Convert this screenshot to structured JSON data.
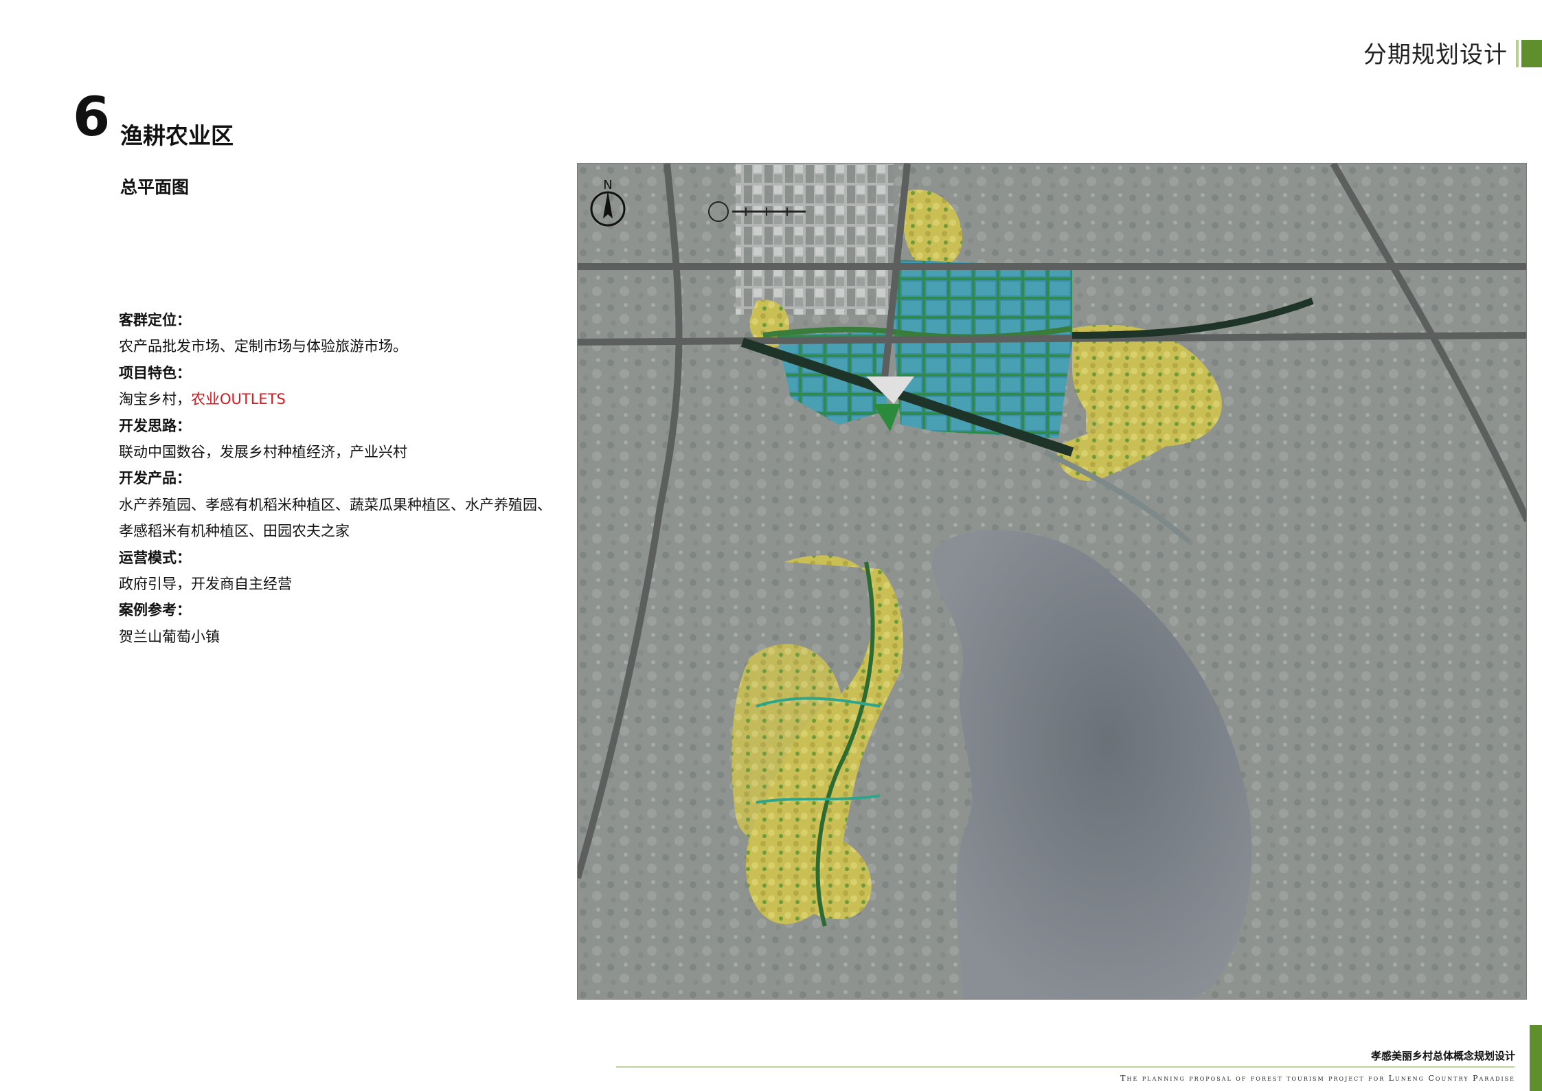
{
  "header": {
    "section_title": "分期规划设计"
  },
  "section": {
    "number": "6",
    "title": "渔耕农业区",
    "subtitle": "总平面图"
  },
  "info": {
    "customer_label": "客群定位：",
    "customer_text": "农产品批发市场、定制市场与体验旅游市场。",
    "feature_label": "项目特色：",
    "feature_text_prefix": "淘宝乡村，",
    "feature_text_highlight": "农业OUTLETS",
    "idea_label": "开发思路：",
    "idea_text": "联动中国数谷，发展乡村种植经济，产业兴村",
    "product_label": "开发产品：",
    "product_text_1": "水产养殖园、孝感有机稻米种植区、蔬菜瓜果种植区、水产养殖园、",
    "product_text_2": "孝感稻米有机种植区、田园农夫之家",
    "operation_label": "运营模式：",
    "operation_text": "政府引导，开发商自主经营",
    "case_label": "案例参考：",
    "case_text": "贺兰山葡萄小镇"
  },
  "map": {
    "north_label": "N"
  },
  "footer": {
    "title_cn": "孝感美丽乡村总体概念规划设计",
    "title_en": "The planning proposal of forest tourism project for Luneng Country Paradise"
  },
  "colors": {
    "accent": "#5f8f2c",
    "highlight": "#d71920",
    "footer_line": "#bcd59a"
  }
}
